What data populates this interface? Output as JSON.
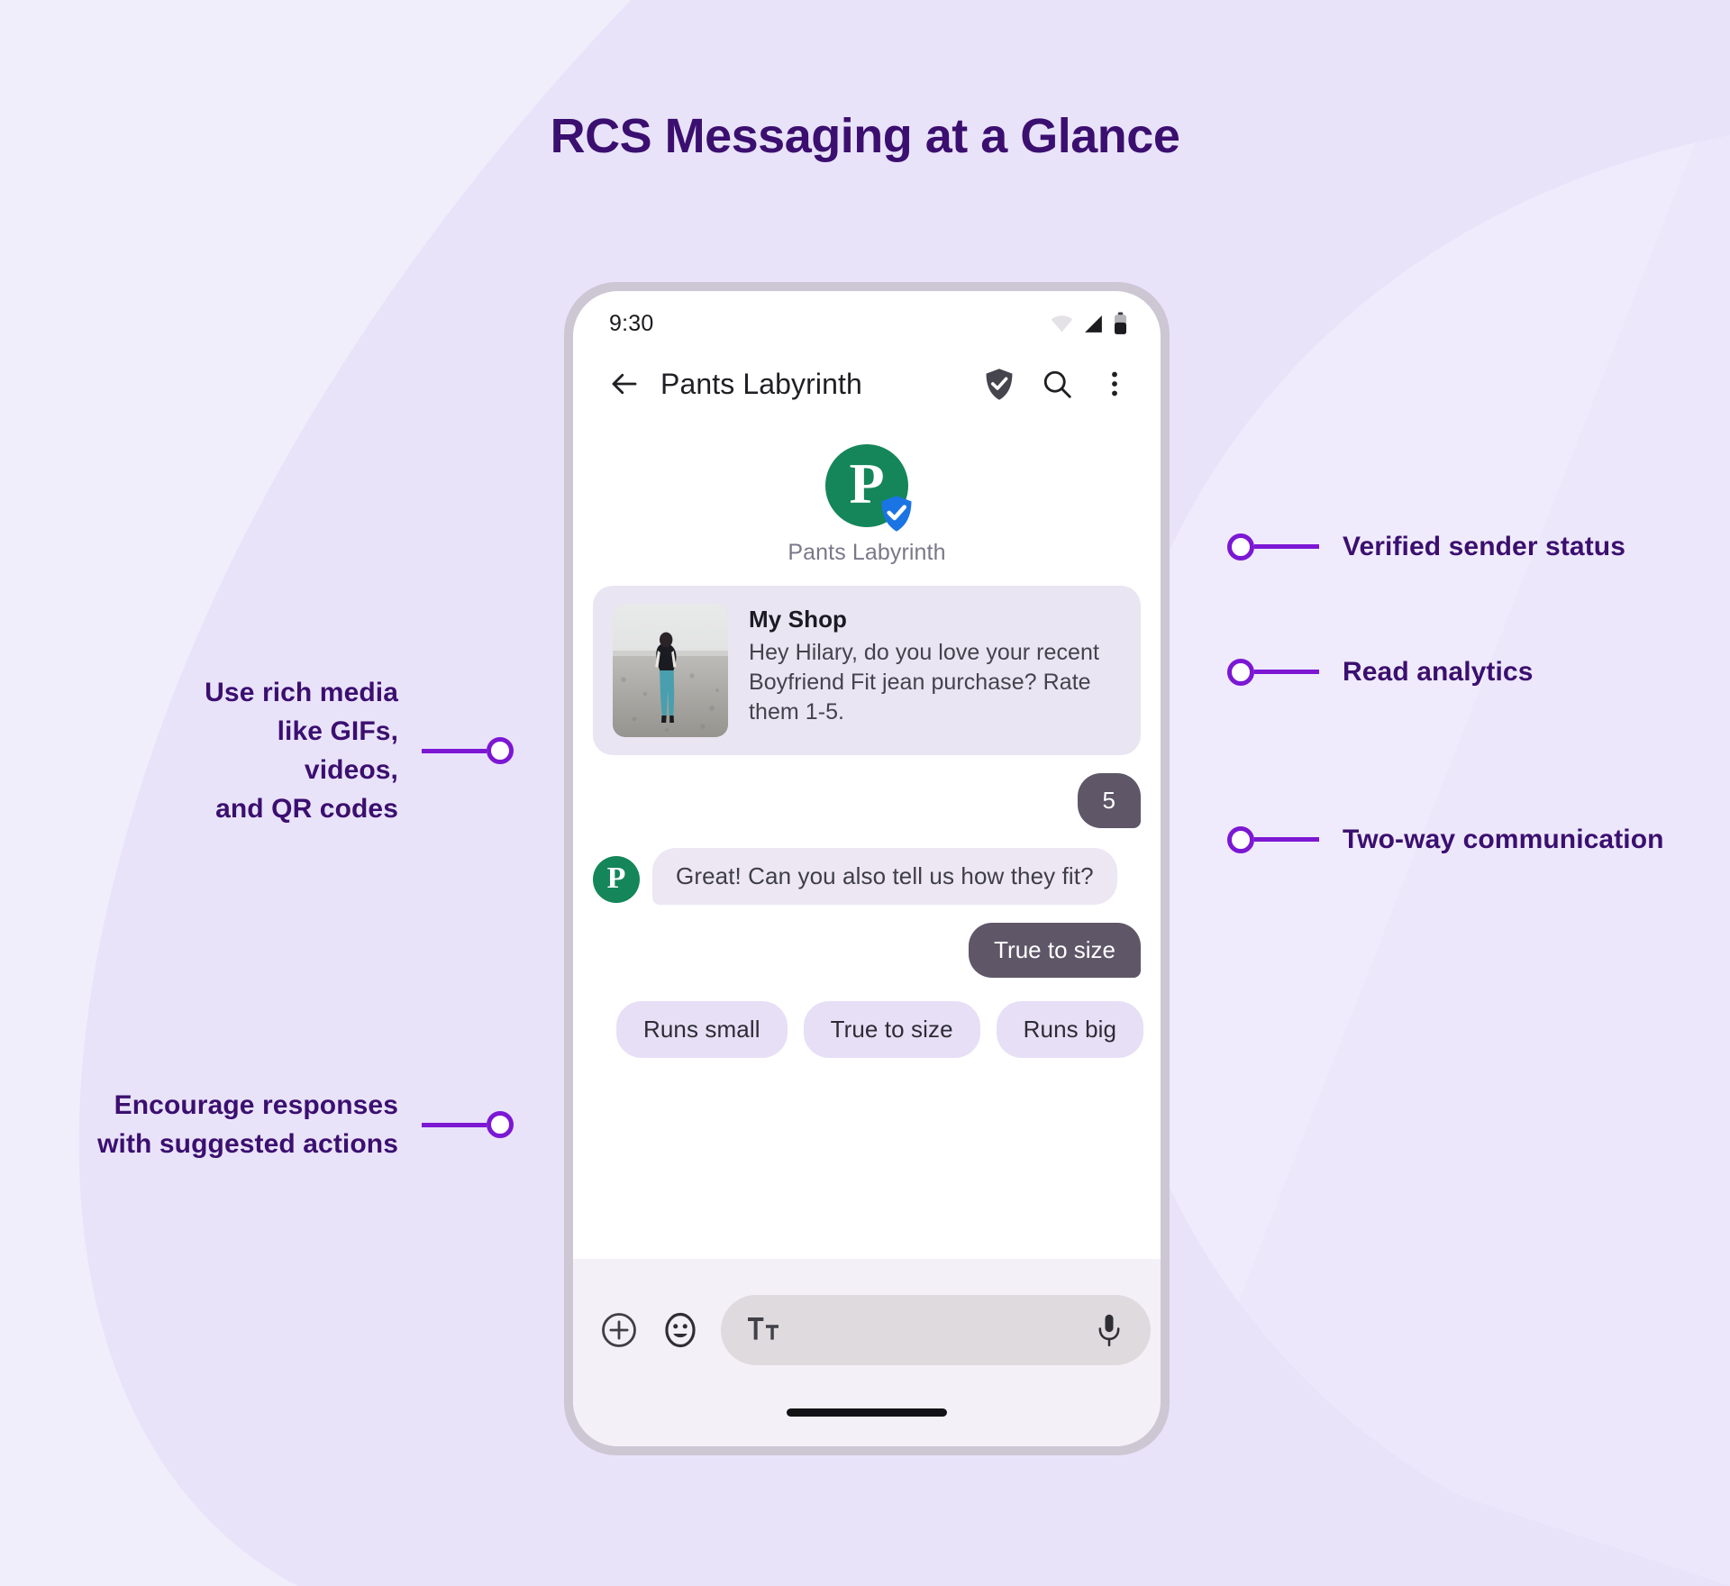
{
  "page": {
    "title": "RCS Messaging at a Glance",
    "background_color": "#f1eefc",
    "blob_color": "#e5dffa",
    "accent_color": "#7c17d4",
    "title_color": "#3b0f6f"
  },
  "phone": {
    "status_bar": {
      "time": "9:30",
      "icons": [
        "wifi-icon",
        "cellular-signal-icon",
        "battery-icon"
      ]
    },
    "app_bar": {
      "back_icon": "back-arrow-icon",
      "title": "Pants Labyrinth",
      "verified_icon": "verified-shield-icon",
      "search_icon": "search-icon",
      "overflow_icon": "overflow-menu-icon"
    },
    "sender": {
      "avatar_letter": "P",
      "avatar_color": "#14865a",
      "badge_color": "#1b74e4",
      "name": "Pants Labyrinth"
    },
    "rich_card": {
      "title": "My Shop",
      "text": "Hey Hilary, do you love your recent Boyfriend Fit jean purchase? Rate them 1-5.",
      "thumbnail_alt": "woman-walking-photo",
      "background": "#eae5f2"
    },
    "messages": [
      {
        "direction": "outgoing",
        "text": "5"
      },
      {
        "direction": "incoming",
        "text": "Great! Can you also tell us how they fit?",
        "avatar_letter": "P"
      },
      {
        "direction": "outgoing",
        "text": "True to size"
      }
    ],
    "suggested_chips": [
      "Runs small",
      "True to size",
      "Runs big"
    ],
    "composer": {
      "add_icon": "plus-circle-icon",
      "emoji_icon": "emoji-smiley-icon",
      "format_icon": "text-format-icon",
      "mic_icon": "microphone-icon",
      "placeholder": "",
      "value": ""
    }
  },
  "annotations": {
    "right": [
      {
        "label": "Verified sender status"
      },
      {
        "label": "Read analytics"
      },
      {
        "label": "Two-way communication"
      }
    ],
    "left": [
      {
        "label": "Use rich media\nlike GIFs, videos,\nand QR codes"
      },
      {
        "label": "Encourage responses\nwith suggested actions"
      }
    ]
  }
}
